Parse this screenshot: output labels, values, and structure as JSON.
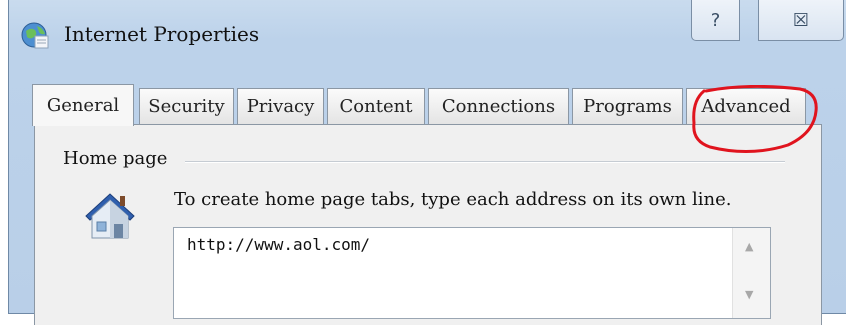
{
  "window": {
    "title": "Internet Properties",
    "help_glyph": "?",
    "close_glyph": "☒"
  },
  "tabs": [
    {
      "label": "General",
      "active": true
    },
    {
      "label": "Security",
      "active": false
    },
    {
      "label": "Privacy",
      "active": false
    },
    {
      "label": "Content",
      "active": false
    },
    {
      "label": "Connections",
      "active": false
    },
    {
      "label": "Programs",
      "active": false
    },
    {
      "label": "Advanced",
      "active": false
    }
  ],
  "home_page": {
    "group_label": "Home page",
    "instruction": "To create home page tabs, type each address on its own line.",
    "address_value": "http://www.aol.com/"
  },
  "icons": {
    "app": "globe-icon",
    "home": "house-icon",
    "scroll_up": "scroll-up-arrow-icon",
    "scroll_down": "scroll-down-arrow-icon"
  },
  "annotation": {
    "color": "#e0141e",
    "target": "Advanced"
  }
}
